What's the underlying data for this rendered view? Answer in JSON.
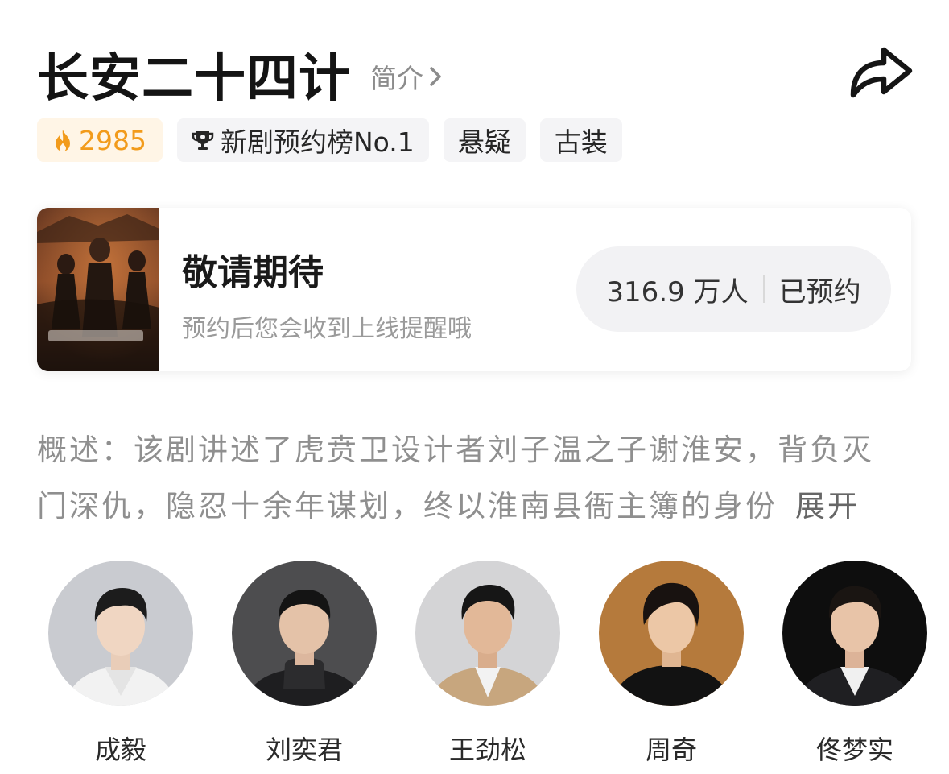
{
  "header": {
    "title": "长安二十四计",
    "intro_label": "简介",
    "share_icon": "share-arrow-icon"
  },
  "tags": {
    "heat_value": "2985",
    "ranking": "新剧预约榜No.1",
    "genre_1": "悬疑",
    "genre_2": "古装"
  },
  "reserve_card": {
    "title": "敬请期待",
    "subtitle": "预约后您会收到上线提醒哦",
    "count": "316.9 万人",
    "status": "已预约"
  },
  "synopsis": {
    "line_1": "概述：该剧讲述了虎贲卫设计者刘子温之子谢淮安，背负灭",
    "line_2": "门深仇，隐忍十余年谋划，终以淮南县衙主簿的身份",
    "expand_label": "展开"
  },
  "cast": [
    {
      "name": "成毅"
    },
    {
      "name": "刘奕君"
    },
    {
      "name": "王劲松"
    },
    {
      "name": "周奇"
    },
    {
      "name": "佟梦实"
    }
  ],
  "colors": {
    "heat_accent": "#f29b1b",
    "heat_bg": "#fff5e6",
    "tag_bg": "#f4f4f6",
    "muted_text": "#8f8f8f"
  }
}
